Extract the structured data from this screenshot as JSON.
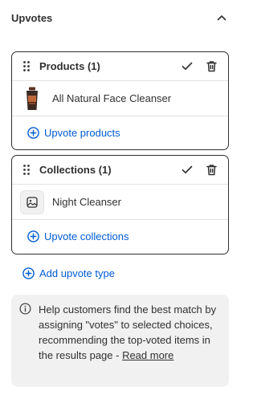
{
  "header": {
    "title": "Upvotes"
  },
  "cards": {
    "products": {
      "title": "Products",
      "count": "(1)",
      "item_name": "All Natural Face Cleanser",
      "add_label": "Upvote products"
    },
    "collections": {
      "title": "Collections",
      "count": "(1)",
      "item_name": "Night Cleanser",
      "add_label": "Upvote collections"
    }
  },
  "add_type_label": "Add upvote type",
  "info": {
    "text": "Help customers find the best match by assigning \"votes\" to selected choices, recommending the top-voted items in the results page - ",
    "link": "Read more"
  },
  "icons": {
    "collapse": "chevron-up-icon",
    "drag": "drag-handle-icon",
    "check": "checkmark-icon",
    "delete": "trash-icon",
    "add": "plus-circle-icon",
    "info": "info-icon",
    "image_placeholder": "image-icon"
  },
  "colors": {
    "link": "#005bd3",
    "text": "#303030",
    "border": "#303030",
    "info_bg": "#f1f1f1"
  }
}
